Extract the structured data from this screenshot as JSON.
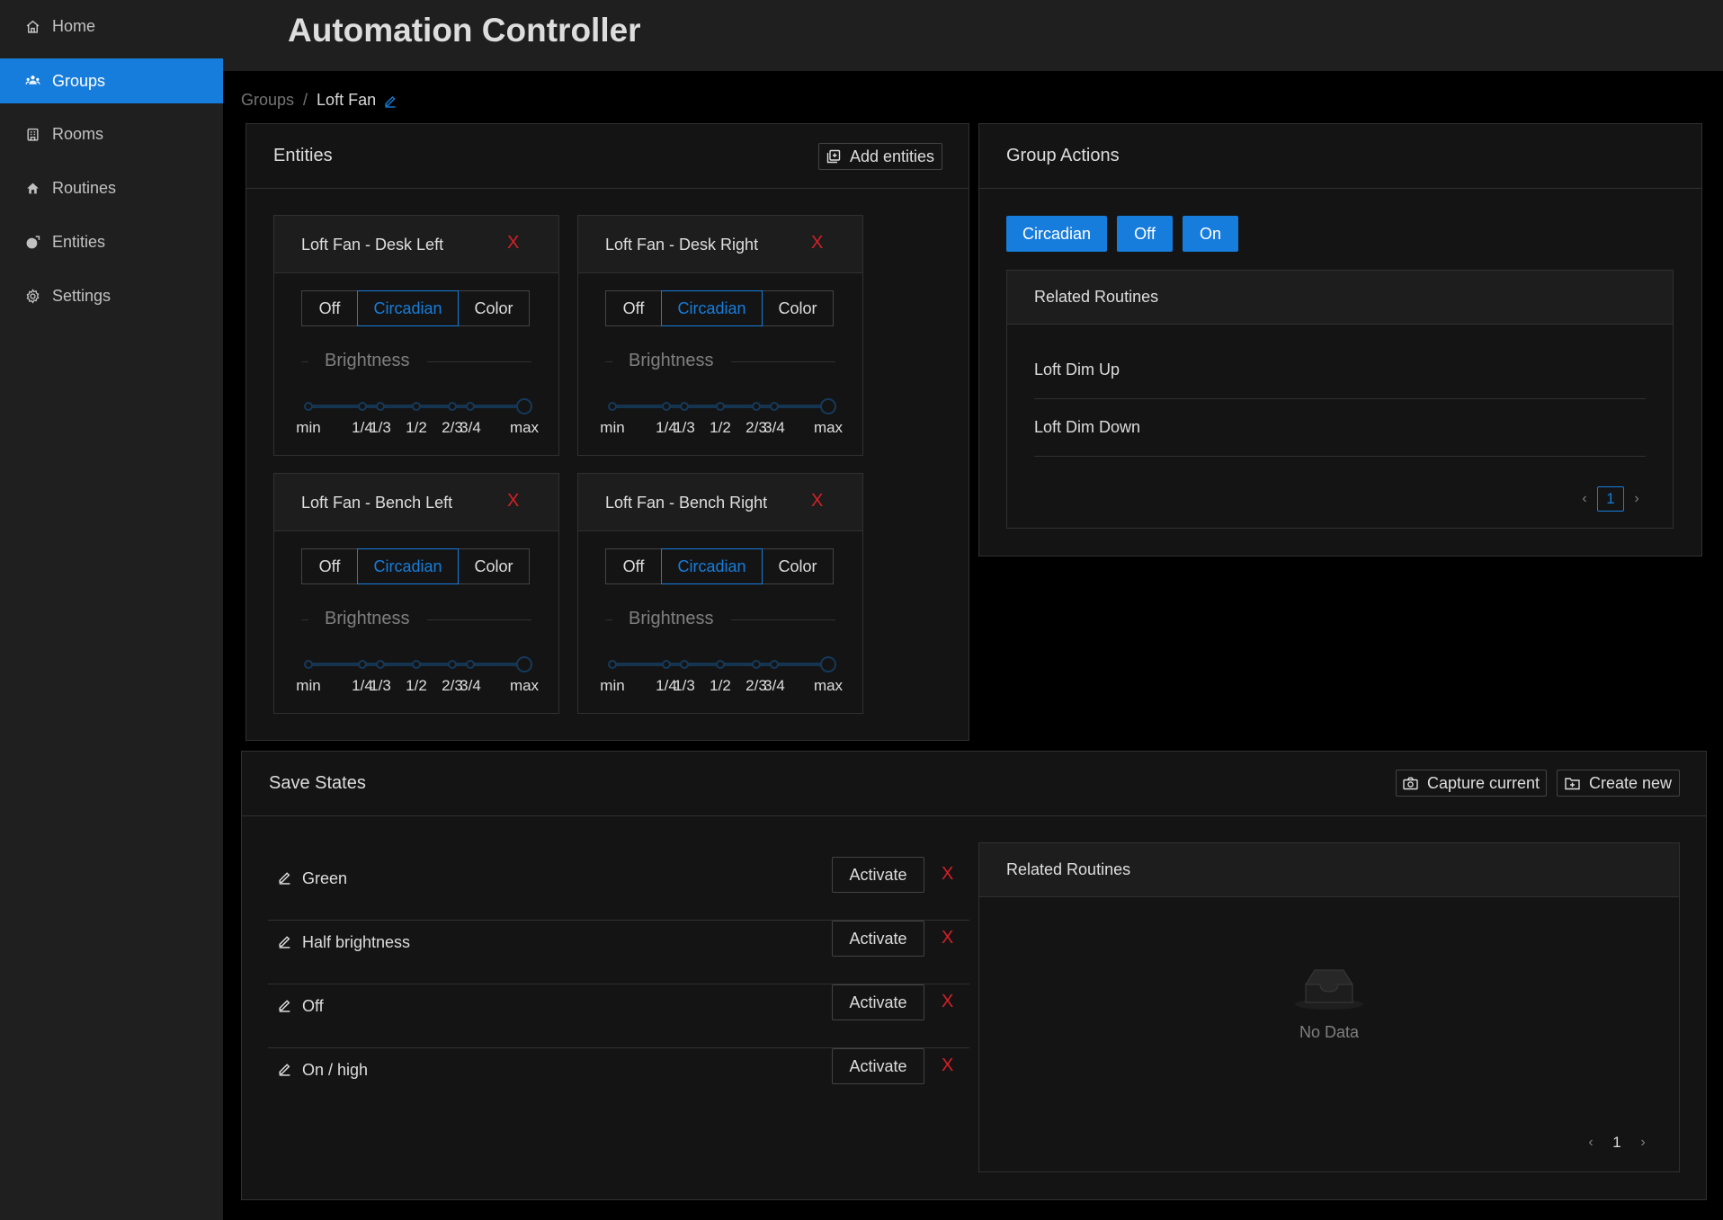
{
  "app": {
    "title": "Automation Controller"
  },
  "sidebar": {
    "items": [
      {
        "label": "Home",
        "icon": "home-icon"
      },
      {
        "label": "Groups",
        "icon": "groups-icon",
        "active": true
      },
      {
        "label": "Rooms",
        "icon": "rooms-icon"
      },
      {
        "label": "Routines",
        "icon": "routines-icon"
      },
      {
        "label": "Entities",
        "icon": "entities-icon"
      },
      {
        "label": "Settings",
        "icon": "gear-icon"
      }
    ]
  },
  "breadcrumb": {
    "parent": "Groups",
    "separator": "/",
    "current": "Loft Fan",
    "edit_icon": "edit-icon"
  },
  "entities_card": {
    "title": "Entities",
    "add_label": "Add entities",
    "remove_symbol": "X",
    "mode_options": [
      "Off",
      "Circadian",
      "Color"
    ],
    "selected_mode": "Circadian",
    "brightness_label": "Brightness",
    "slider_marks": [
      "min",
      "1/4",
      "1/3",
      "1/2",
      "2/3",
      "3/4",
      "max"
    ],
    "items": [
      {
        "name": "Loft Fan - Desk Left",
        "mode": "Circadian",
        "brightness": "max"
      },
      {
        "name": "Loft Fan - Desk Right",
        "mode": "Circadian",
        "brightness": "max"
      },
      {
        "name": "Loft Fan - Bench Left",
        "mode": "Circadian",
        "brightness": "max"
      },
      {
        "name": "Loft Fan - Bench Right",
        "mode": "Circadian",
        "brightness": "max"
      }
    ]
  },
  "group_actions": {
    "title": "Group Actions",
    "buttons": [
      "Circadian",
      "Off",
      "On"
    ],
    "related_routines": {
      "title": "Related Routines",
      "items": [
        "Loft Dim Up",
        "Loft Dim Down"
      ],
      "current_page": "1"
    }
  },
  "save_states": {
    "title": "Save States",
    "capture_label": "Capture current",
    "create_label": "Create new",
    "activate_label": "Activate",
    "remove_symbol": "X",
    "items": [
      "Green",
      "Half brightness",
      "Off",
      "On / high"
    ],
    "related_routines": {
      "title": "Related Routines",
      "empty_text": "No Data",
      "current_page": "1"
    }
  },
  "colors": {
    "accent": "#177ddc",
    "danger": "#d32029",
    "sidebar_bg": "#1f1f1f",
    "card_bg": "#141414",
    "page_bg": "#000000"
  }
}
